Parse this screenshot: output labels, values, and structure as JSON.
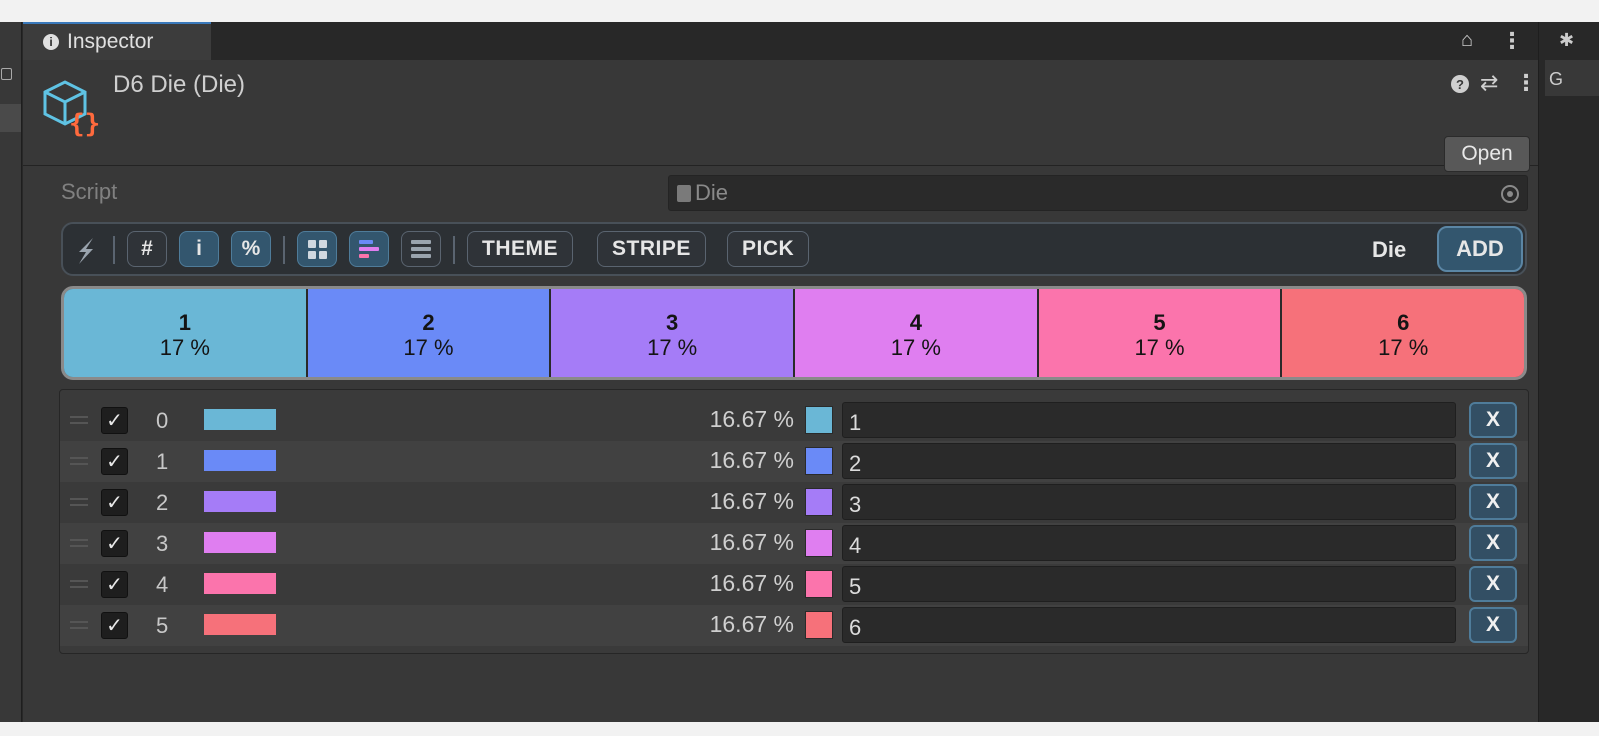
{
  "tab": {
    "label": "Inspector"
  },
  "right_panel": {
    "tab_letter": "G",
    "icon": "gear-icon"
  },
  "header": {
    "title": "D6 Die (Die)",
    "open_label": "Open",
    "help_glyph": "?",
    "preset_glyph": "⇄",
    "kebab_glyph": "⋮"
  },
  "script": {
    "label": "Script",
    "value": "Die"
  },
  "toolbar": {
    "hash_label": "#",
    "info_label": "i",
    "percent_label": "%",
    "theme_label": "THEME",
    "stripe_label": "STRIPE",
    "pick_label": "PICK",
    "type_label": "Die",
    "add_label": "ADD"
  },
  "colors": [
    "#6ab7d6",
    "#6a8af7",
    "#a57cf7",
    "#df7ef0",
    "#fb74ac",
    "#f6717a"
  ],
  "distribution": [
    {
      "label": "1",
      "percent": "17 %"
    },
    {
      "label": "2",
      "percent": "17 %"
    },
    {
      "label": "3",
      "percent": "17 %"
    },
    {
      "label": "4",
      "percent": "17 %"
    },
    {
      "label": "5",
      "percent": "17 %"
    },
    {
      "label": "6",
      "percent": "17 %"
    }
  ],
  "entries": [
    {
      "index": "0",
      "checked": true,
      "percent": "16.67 %",
      "value": "1",
      "remove_label": "X"
    },
    {
      "index": "1",
      "checked": true,
      "percent": "16.67 %",
      "value": "2",
      "remove_label": "X"
    },
    {
      "index": "2",
      "checked": true,
      "percent": "16.67 %",
      "value": "3",
      "remove_label": "X"
    },
    {
      "index": "3",
      "checked": true,
      "percent": "16.67 %",
      "value": "4",
      "remove_label": "X"
    },
    {
      "index": "4",
      "checked": true,
      "percent": "16.67 %",
      "value": "5",
      "remove_label": "X"
    },
    {
      "index": "5",
      "checked": true,
      "percent": "16.67 %",
      "value": "6",
      "remove_label": "X"
    }
  ]
}
